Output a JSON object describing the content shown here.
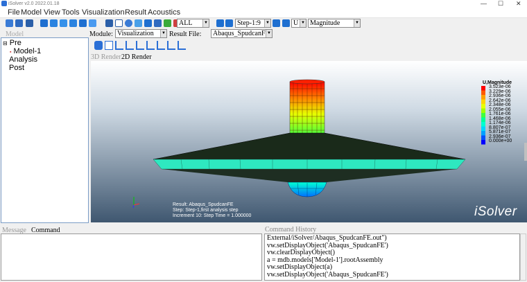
{
  "window": {
    "title": "iSolver v2.0 2022.01.18"
  },
  "menu": [
    "File",
    "Model",
    "View",
    "Tools",
    "Visualization",
    "Result",
    "Acoustics"
  ],
  "toolbar": {
    "filter_select": "ALL",
    "step_select": "Step-1:9",
    "variable_select": "U",
    "component_select": "Magnitude"
  },
  "module_row": {
    "module_label": "Module:",
    "module_value": "Visualization",
    "result_label": "Result File:",
    "result_value": "Abaqus_SpudcanFE"
  },
  "model_panel": {
    "label": "Model",
    "tree": [
      {
        "text": "Pre",
        "prefix": "⊟"
      },
      {
        "text": "Model-1",
        "prefix": "▪"
      },
      {
        "text": "Analysis",
        "prefix": ""
      },
      {
        "text": "Post",
        "prefix": ""
      }
    ]
  },
  "render_tabs": {
    "tab_3d": "3D Render",
    "tab_2d": "2D Render"
  },
  "legend": {
    "title": "U,Magnitude",
    "labels": [
      "3.523e-06",
      "3.229e-06",
      "2.936e-06",
      "2.642e-06",
      "2.348e-06",
      "2.055e-06",
      "1.761e-06",
      "1.468e-06",
      "1.174e-06",
      "8.807e-07",
      "5.871e-07",
      "2.936e-07",
      "0.000e+00"
    ],
    "colors": [
      "#ff0000",
      "#ff5a00",
      "#ffa000",
      "#ffd400",
      "#e6ff00",
      "#a0ff00",
      "#40ff40",
      "#00ff9a",
      "#00ffd2",
      "#00d6ff",
      "#00a0ff",
      "#0050ff",
      "#0000ff"
    ]
  },
  "info": {
    "result": "Result: Abaqus_SpudcanFE",
    "step": "Step: Step-1,first analysis step",
    "increment": "Increment      10: Step Time =    1.000000"
  },
  "brand": "iSolver",
  "message_panel": {
    "tab_message": "Message",
    "tab_command": "Command"
  },
  "history": {
    "label": "Command History",
    "lines": [
      "External/iSolver/Abaqus_SpudcanFE.out\")",
      "vw.setDisplayObject('Abaqus_SpudcanFE')",
      "vw.clearDisplayObject()",
      "a = mdb.models['Model-1'].rootAssembly",
      "vw.setDisplayObject(a)",
      "vw.setDisplayObject('Abaqus_SpudcanFE')"
    ]
  }
}
